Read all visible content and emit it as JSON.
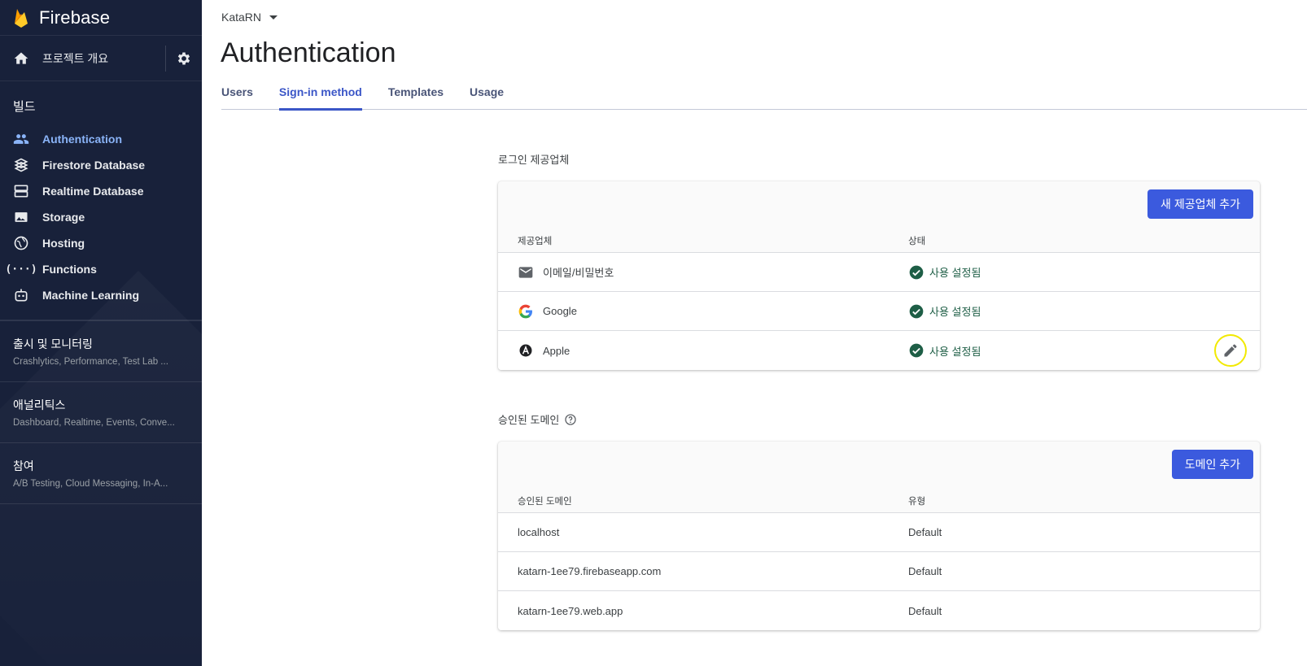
{
  "sidebar": {
    "brand": "Firebase",
    "overview_label": "프로젝트 개요",
    "build_title": "빌드",
    "items": [
      {
        "label": "Authentication",
        "icon": "people-icon"
      },
      {
        "label": "Firestore Database",
        "icon": "firestore-icon"
      },
      {
        "label": "Realtime Database",
        "icon": "database-icon"
      },
      {
        "label": "Storage",
        "icon": "image-icon"
      },
      {
        "label": "Hosting",
        "icon": "globe-icon"
      },
      {
        "label": "Functions",
        "icon": "functions-icon"
      },
      {
        "label": "Machine Learning",
        "icon": "robot-icon"
      }
    ],
    "groups": [
      {
        "title": "출시 및 모니터링",
        "subtitle": "Crashlytics, Performance, Test Lab ..."
      },
      {
        "title": "애널리틱스",
        "subtitle": "Dashboard, Realtime, Events, Conve..."
      },
      {
        "title": "참여",
        "subtitle": "A/B Testing, Cloud Messaging, In-A..."
      }
    ]
  },
  "header": {
    "project": "KataRN",
    "title": "Authentication",
    "tabs": [
      "Users",
      "Sign-in method",
      "Templates",
      "Usage"
    ]
  },
  "providers": {
    "section_title": "로그인 제공업체",
    "add_button": "새 제공업체 추가",
    "col_provider": "제공업체",
    "col_status": "상태",
    "rows": [
      {
        "name": "이메일/비밀번호",
        "status": "사용 설정됨",
        "icon": "mail-icon"
      },
      {
        "name": "Google",
        "status": "사용 설정됨",
        "icon": "google-icon"
      },
      {
        "name": "Apple",
        "status": "사용 설정됨",
        "icon": "apple-icon"
      }
    ]
  },
  "domains": {
    "section_title": "승인된 도메인",
    "add_button": "도메인 추가",
    "col_domain": "승인된 도메인",
    "col_type": "유형",
    "rows": [
      {
        "domain": "localhost",
        "type": "Default"
      },
      {
        "domain": "katarn-1ee79.firebaseapp.com",
        "type": "Default"
      },
      {
        "domain": "katarn-1ee79.web.app",
        "type": "Default"
      }
    ]
  },
  "colors": {
    "sidebar_bg": "#18213a",
    "active_nav": "#8ab4f8",
    "accent": "#3b5ade",
    "status_green": "#1e5e46",
    "highlight_ring": "#f2e900"
  }
}
